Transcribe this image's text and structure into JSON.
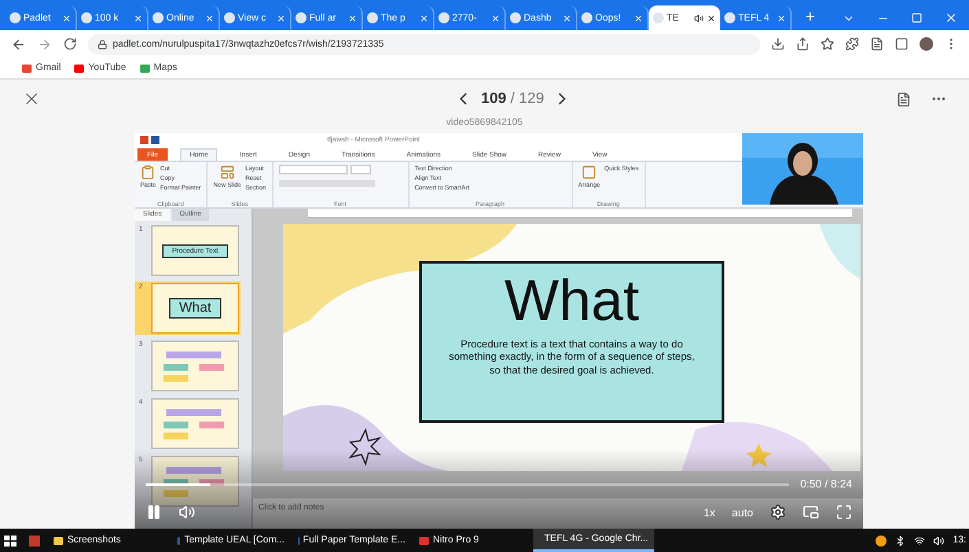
{
  "browser": {
    "tabs": [
      {
        "label": "Padlet",
        "selected": false,
        "audio": false
      },
      {
        "label": "100 k",
        "selected": false,
        "audio": false
      },
      {
        "label": "Online",
        "selected": false,
        "audio": false
      },
      {
        "label": "View c",
        "selected": false,
        "audio": false
      },
      {
        "label": "Full ar",
        "selected": false,
        "audio": false
      },
      {
        "label": "The p",
        "selected": false,
        "audio": false
      },
      {
        "label": "2770-",
        "selected": false,
        "audio": false
      },
      {
        "label": "Dashb",
        "selected": false,
        "audio": false
      },
      {
        "label": "Oops!",
        "selected": false,
        "audio": false
      },
      {
        "label": "TE",
        "selected": true,
        "audio": true
      },
      {
        "label": "TEFL 4",
        "selected": false,
        "audio": false
      }
    ],
    "new_tab": "+",
    "address": "padlet.com/nurulpuspita17/3nwqtazhz0efcs7r/wish/2193721335",
    "bookmarks": [
      {
        "label": "Gmail",
        "color": "#ea4335"
      },
      {
        "label": "YouTube",
        "color": "#ff0000"
      },
      {
        "label": "Maps",
        "color": "#34a853"
      }
    ]
  },
  "viewer": {
    "page_current": "109",
    "page_total": "/ 129",
    "title": "video5869842105"
  },
  "powerpoint": {
    "title": "tfjawab - Microsoft PowerPoint",
    "ribbon_tabs": [
      {
        "label": "File",
        "selected": false,
        "kind": "file"
      },
      {
        "label": "Home",
        "selected": true,
        "kind": "tab"
      },
      {
        "label": "Insert",
        "selected": false,
        "kind": "tab"
      },
      {
        "label": "Design",
        "selected": false,
        "kind": "tab"
      },
      {
        "label": "Transitions",
        "selected": false,
        "kind": "tab"
      },
      {
        "label": "Animations",
        "selected": false,
        "kind": "tab"
      },
      {
        "label": "Slide Show",
        "selected": false,
        "kind": "tab"
      },
      {
        "label": "Review",
        "selected": false,
        "kind": "tab"
      },
      {
        "label": "View",
        "selected": false,
        "kind": "tab"
      }
    ],
    "groups": [
      {
        "label": "Clipboard",
        "big": "Paste",
        "items": [
          "Cut",
          "Copy",
          "Format Painter"
        ]
      },
      {
        "label": "Slides",
        "big": "New Slide",
        "items": [
          "Layout",
          "Reset",
          "Section"
        ]
      },
      {
        "label": "Font"
      },
      {
        "label": "Paragraph",
        "items": [
          "Text Direction",
          "Align Text",
          "Convert to SmartArt"
        ]
      },
      {
        "label": "Drawing",
        "big": "Arrange",
        "items": [
          "Quick Styles"
        ]
      }
    ],
    "pane_tabs": [
      {
        "label": "Slides",
        "selected": true
      },
      {
        "label": "Outline",
        "selected": false
      }
    ],
    "thumbnails": [
      {
        "number": "1",
        "title": "Procedure Text",
        "selected": false
      },
      {
        "number": "2",
        "title": "What",
        "selected": true
      },
      {
        "number": "3",
        "selected": false
      },
      {
        "number": "4",
        "selected": false
      },
      {
        "number": "5",
        "selected": false
      }
    ],
    "slide": {
      "heading": "What",
      "body": "Procedure text is a text that contains a way to do something exactly, in the form of a sequence of steps, so that the desired goal is achieved."
    },
    "notes_placeholder": "Click to add notes"
  },
  "player": {
    "level": 0.1,
    "time": "0:50 / 8:24",
    "speed": "1x",
    "quality": "auto",
    "playing": true
  },
  "taskbar": {
    "items": [
      {
        "label": "Screenshots",
        "selected": false,
        "kind": "folder"
      },
      {
        "label": "Template UEAL [Com...",
        "selected": false,
        "kind": "word"
      },
      {
        "label": "Full Paper Template E...",
        "selected": false,
        "kind": "word"
      },
      {
        "label": "Nitro Pro 9",
        "selected": false,
        "kind": "pdf"
      },
      {
        "label": "TEFL 4G - Google Chr...",
        "selected": true,
        "kind": "chrome"
      }
    ],
    "clock": "13:"
  }
}
